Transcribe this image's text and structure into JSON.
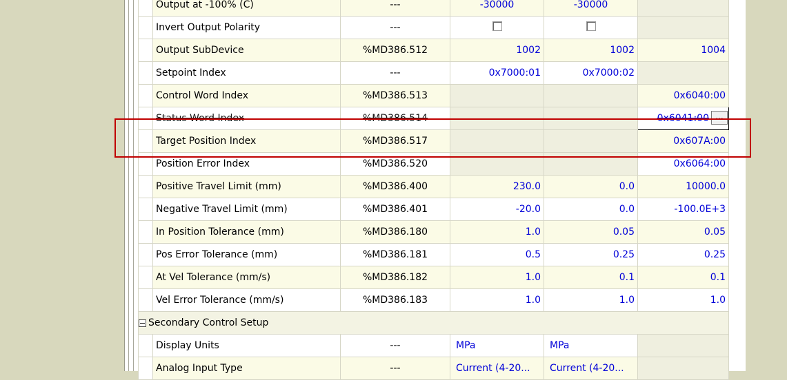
{
  "highlight": {
    "color": "#c00000",
    "target": "Target Position Index"
  },
  "rows": [
    {
      "name": "Output at -100% (C)",
      "addr": "---",
      "v1": "-30000",
      "v2": "-30000",
      "v3": ""
    },
    {
      "name": "Invert Output Polarity",
      "addr": "---",
      "v1": "checkbox-unchecked",
      "v2": "checkbox-unchecked",
      "v3": ""
    },
    {
      "name": "Output SubDevice",
      "addr": "%MD386.512",
      "v1": "1002",
      "v2": "1002",
      "v3": "1004"
    },
    {
      "name": "Setpoint Index",
      "addr": "---",
      "v1": "0x7000:01",
      "v2": "0x7000:02",
      "v3": ""
    },
    {
      "name": "Control Word Index",
      "addr": "%MD386.513",
      "v1": "",
      "v2": "",
      "v3": "0x6040:00"
    },
    {
      "name": "Status Word Index",
      "addr": "%MD386.514",
      "v1": "",
      "v2": "",
      "v3": "0x6041:00",
      "ellipsis": "..."
    },
    {
      "name": "Target Position Index",
      "addr": "%MD386.517",
      "v1": "",
      "v2": "",
      "v3": "0x607A:00"
    },
    {
      "name": "Position Error Index",
      "addr": "%MD386.520",
      "v1": "",
      "v2": "",
      "v3": "0x6064:00"
    },
    {
      "name": "Positive Travel Limit (mm)",
      "addr": "%MD386.400",
      "v1": "230.0",
      "v2": "0.0",
      "v3": "10000.0"
    },
    {
      "name": "Negative Travel Limit (mm)",
      "addr": "%MD386.401",
      "v1": "-20.0",
      "v2": "0.0",
      "v3": "-100.0E+3"
    },
    {
      "name": "In Position Tolerance (mm)",
      "addr": "%MD386.180",
      "v1": "1.0",
      "v2": "0.05",
      "v3": "0.05"
    },
    {
      "name": "Pos Error Tolerance (mm)",
      "addr": "%MD386.181",
      "v1": "0.5",
      "v2": "0.25",
      "v3": "0.25"
    },
    {
      "name": "At Vel Tolerance (mm/s)",
      "addr": "%MD386.182",
      "v1": "1.0",
      "v2": "0.1",
      "v3": "0.1"
    },
    {
      "name": "Vel Error Tolerance (mm/s)",
      "addr": "%MD386.183",
      "v1": "1.0",
      "v2": "1.0",
      "v3": "1.0"
    }
  ],
  "section": {
    "label": "Secondary Control Setup"
  },
  "section_rows": [
    {
      "name": "Display Units",
      "addr": "---",
      "v1": "MPa",
      "v2": "MPa",
      "v3": ""
    },
    {
      "name": "Analog Input Type",
      "addr": "---",
      "v1": "Current (4-20...",
      "v2": "Current (4-20...",
      "v3": ""
    }
  ]
}
